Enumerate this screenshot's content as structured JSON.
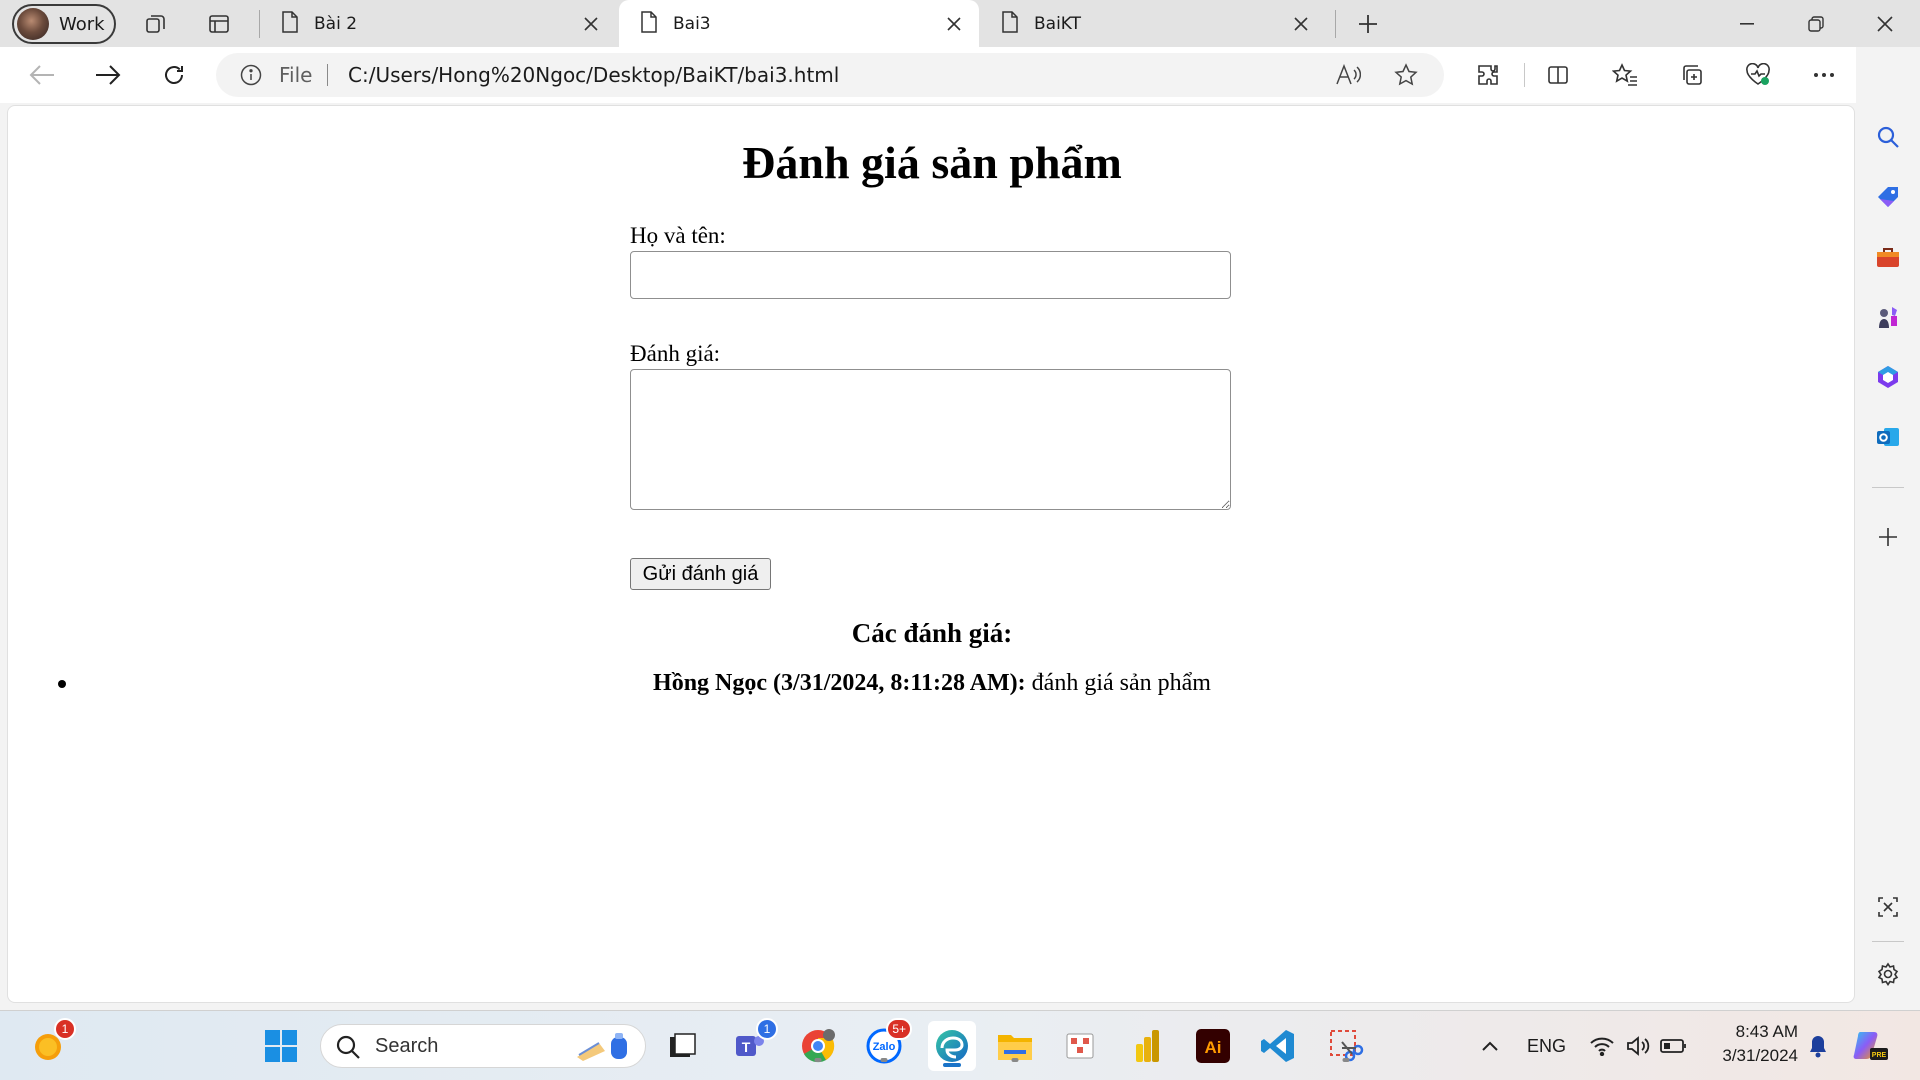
{
  "browser": {
    "profile_label": "Work",
    "tabs": [
      {
        "title": "Bài 2",
        "active": false
      },
      {
        "title": "Bai3",
        "active": true
      },
      {
        "title": "BaiKT",
        "active": false
      }
    ],
    "address": {
      "scheme_label": "File",
      "url": "C:/Users/Hong%20Ngoc/Desktop/BaiKT/bai3.html"
    }
  },
  "page": {
    "heading": "Đánh giá sản phẩm",
    "name_label": "Họ và tên:",
    "name_value": "",
    "review_label": "Đánh giá:",
    "review_value": "",
    "submit_label": "Gửi đánh giá",
    "reviews_heading": "Các đánh giá:",
    "reviews": [
      {
        "author_and_time": "Hồng Ngọc (3/31/2024, 8:11:28 AM):",
        "text": " đánh giá sản phẩm"
      }
    ]
  },
  "taskbar": {
    "search_placeholder": "Search",
    "badges": {
      "weather": "1",
      "teams": "1",
      "zalo": "5+"
    },
    "illustrator_label": "Ai",
    "language": "ENG",
    "time": "8:43 AM",
    "date": "3/31/2024"
  },
  "colors": {
    "accent": "#1a73c8",
    "badge": "#d93025"
  }
}
